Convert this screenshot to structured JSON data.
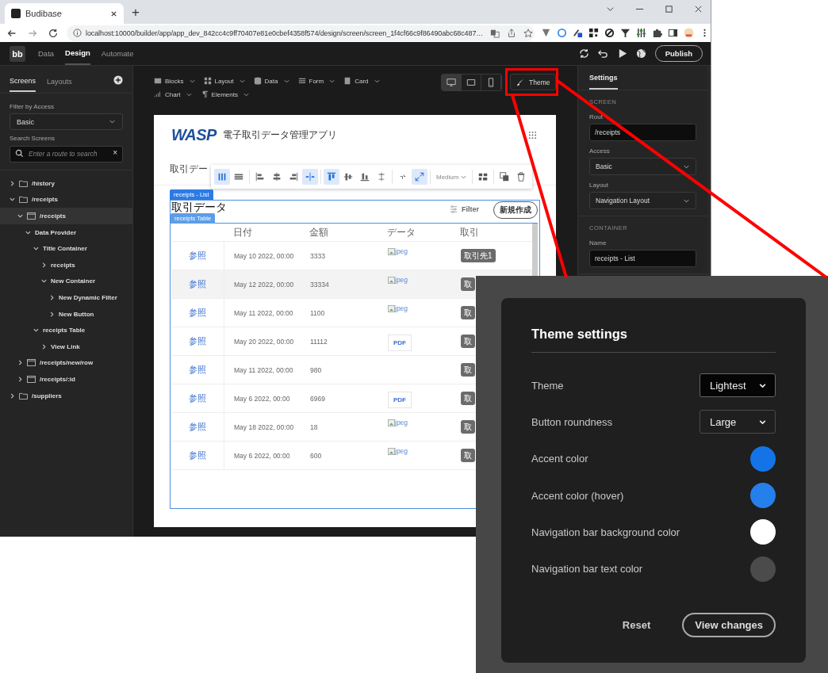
{
  "browser": {
    "tab_title": "Budibase",
    "new_tab": "+",
    "url": "localhost:10000/builder/app/app_dev_842cc4c9ff70407e81e0cbef4358f574/design/screen/screen_1f4cf66c9f86490abc68c487…"
  },
  "app_bar": {
    "logo": "bb",
    "nav": [
      {
        "label": "Data",
        "selected": false
      },
      {
        "label": "Design",
        "selected": true
      },
      {
        "label": "Automate",
        "selected": false
      }
    ],
    "publish": "Publish"
  },
  "sidebar": {
    "tabs": [
      {
        "label": "Screens",
        "selected": true
      },
      {
        "label": "Layouts",
        "selected": false
      }
    ],
    "filter_label": "Filter by Access",
    "filter_value": "Basic",
    "search_label": "Search Screens",
    "search": {
      "placeholder": "Enter a route to search"
    },
    "clear": "×",
    "tree": [
      {
        "label": "/history",
        "kind": "folder",
        "expanded": false,
        "selected": false
      },
      {
        "label": "/receipts",
        "kind": "folder",
        "expanded": true,
        "selected": false,
        "children": [
          {
            "label": "/receipts",
            "kind": "screen",
            "expanded": true,
            "selected": true,
            "children": [
              {
                "label": "Data Provider",
                "expanded": true,
                "selected": false,
                "children": [
                  {
                    "label": "Title Container",
                    "expanded": true,
                    "selected": false,
                    "children": [
                      {
                        "label": "receipts",
                        "expanded": false,
                        "selected": false
                      },
                      {
                        "label": "New Container",
                        "expanded": true,
                        "selected": false,
                        "children": [
                          {
                            "label": "New Dynamic Filter",
                            "expanded": false,
                            "selected": false
                          },
                          {
                            "label": "New Button",
                            "expanded": false,
                            "selected": false
                          }
                        ]
                      }
                    ]
                  },
                  {
                    "label": "receipts Table",
                    "expanded": true,
                    "selected": false,
                    "children": [
                      {
                        "label": "View Link",
                        "expanded": false,
                        "selected": false
                      }
                    ]
                  }
                ]
              }
            ]
          },
          {
            "label": "/receipts/new/row",
            "kind": "screen",
            "expanded": false,
            "selected": false
          },
          {
            "label": "/receipts/:id",
            "kind": "screen",
            "expanded": false,
            "selected": false
          }
        ]
      },
      {
        "label": "/suppliers",
        "kind": "folder",
        "expanded": false,
        "selected": false
      }
    ]
  },
  "canvas_toolbar": {
    "menus": [
      {
        "label": "Blocks",
        "kind": "blocks"
      },
      {
        "label": "Layout",
        "kind": "layout"
      },
      {
        "label": "Data",
        "kind": "data"
      },
      {
        "label": "Form",
        "kind": "form"
      },
      {
        "label": "Card",
        "kind": "card"
      },
      {
        "label": "Chart",
        "kind": "chart"
      },
      {
        "label": "Elements",
        "kind": "elements"
      }
    ],
    "devices": [
      {
        "kind": "desktop",
        "selected": true
      },
      {
        "kind": "tablet",
        "selected": false
      },
      {
        "kind": "mobile",
        "selected": false
      }
    ],
    "theme_button": "Theme"
  },
  "preview": {
    "logo": "WASP",
    "app_title": "電子取引データ管理アプリ",
    "page_title": "取引デー",
    "toolbar": {
      "tools": [
        {
          "kind": "columns",
          "selected": true
        },
        {
          "kind": "rows",
          "selected": false
        },
        {
          "kind": "align-left",
          "selected": false
        },
        {
          "kind": "align-center",
          "selected": false
        },
        {
          "kind": "align-right",
          "selected": false
        },
        {
          "kind": "spread",
          "selected": true
        },
        {
          "kind": "align-top",
          "selected": true
        },
        {
          "kind": "align-middle",
          "selected": false
        },
        {
          "kind": "align-bottom",
          "selected": false
        },
        {
          "kind": "stretch",
          "selected": false
        },
        {
          "kind": "shrink",
          "selected": false
        },
        {
          "kind": "grow",
          "selected": true
        }
      ],
      "size": "Medium"
    },
    "list_tag": "receipts - List",
    "heading": "取引データ",
    "table_tag": "receipts Table",
    "filter": "Filter",
    "new_button": "新規作成",
    "table": {
      "columns": [
        "日付",
        "金額",
        "データ",
        "取引"
      ],
      "rows": [
        {
          "link": "参照",
          "date": "May 10 2022, 00:00",
          "amount": "3333",
          "data": {
            "kind": "image",
            "text": "jpeg"
          },
          "partner": "取引先1",
          "highlighted": false
        },
        {
          "link": "参照",
          "date": "May 12 2022, 00:00",
          "amount": "33334",
          "data": {
            "kind": "image",
            "text": "jpeg"
          },
          "partner": "取",
          "highlighted": true
        },
        {
          "link": "参照",
          "date": "May 11 2022, 00:00",
          "amount": "1100",
          "data": {
            "kind": "image",
            "text": "jpeg"
          },
          "partner": "取",
          "highlighted": false
        },
        {
          "link": "参照",
          "date": "May 20 2022, 00:00",
          "amount": "11112",
          "data": {
            "kind": "pdf",
            "text": "PDF"
          },
          "partner": "取",
          "highlighted": false
        },
        {
          "link": "参照",
          "date": "May 11 2022, 00:00",
          "amount": "980",
          "partner": "取",
          "highlighted": false
        },
        {
          "link": "参照",
          "date": "May 6 2022, 00:00",
          "amount": "6969",
          "data": {
            "kind": "pdf",
            "text": "PDF"
          },
          "partner": "取",
          "highlighted": false
        },
        {
          "link": "参照",
          "date": "May 18 2022, 00:00",
          "amount": "18",
          "data": {
            "kind": "image",
            "text": "jpeg"
          },
          "partner": "取",
          "highlighted": false
        },
        {
          "link": "参照",
          "date": "May 6 2022, 00:00",
          "amount": "600",
          "data": {
            "kind": "image",
            "text": "jpeg"
          },
          "partner": "取",
          "highlighted": false
        }
      ]
    }
  },
  "settings": {
    "tab": "Settings",
    "sections": [
      {
        "title": "SCREEN",
        "fields": [
          {
            "label": "Rout",
            "kind": "text",
            "value": "/receipts"
          },
          {
            "label": "Access",
            "kind": "select",
            "value": "Basic"
          },
          {
            "label": "Layout",
            "kind": "select",
            "value": "Navigation Layout"
          }
        ]
      },
      {
        "title": "CONTAINER",
        "fields": [
          {
            "label": "Name",
            "kind": "text",
            "value": "receipts - List"
          }
        ]
      }
    ]
  },
  "theme_settings": {
    "title": "Theme settings",
    "rows": [
      {
        "label": "Theme",
        "kind": "select",
        "value": "Lightest",
        "focused": true
      },
      {
        "label": "Button roundness",
        "kind": "select",
        "value": "Large",
        "focused": false
      },
      {
        "label": "Accent color",
        "kind": "color",
        "color": "#1473e6"
      },
      {
        "label": "Accent color (hover)",
        "kind": "color",
        "color": "#2680eb"
      },
      {
        "label": "Navigation bar background color",
        "kind": "color",
        "color": "#ffffff"
      },
      {
        "label": "Navigation bar text color",
        "kind": "color",
        "color": "#4b4b4b"
      }
    ],
    "reset": "Reset",
    "apply": "View changes"
  }
}
